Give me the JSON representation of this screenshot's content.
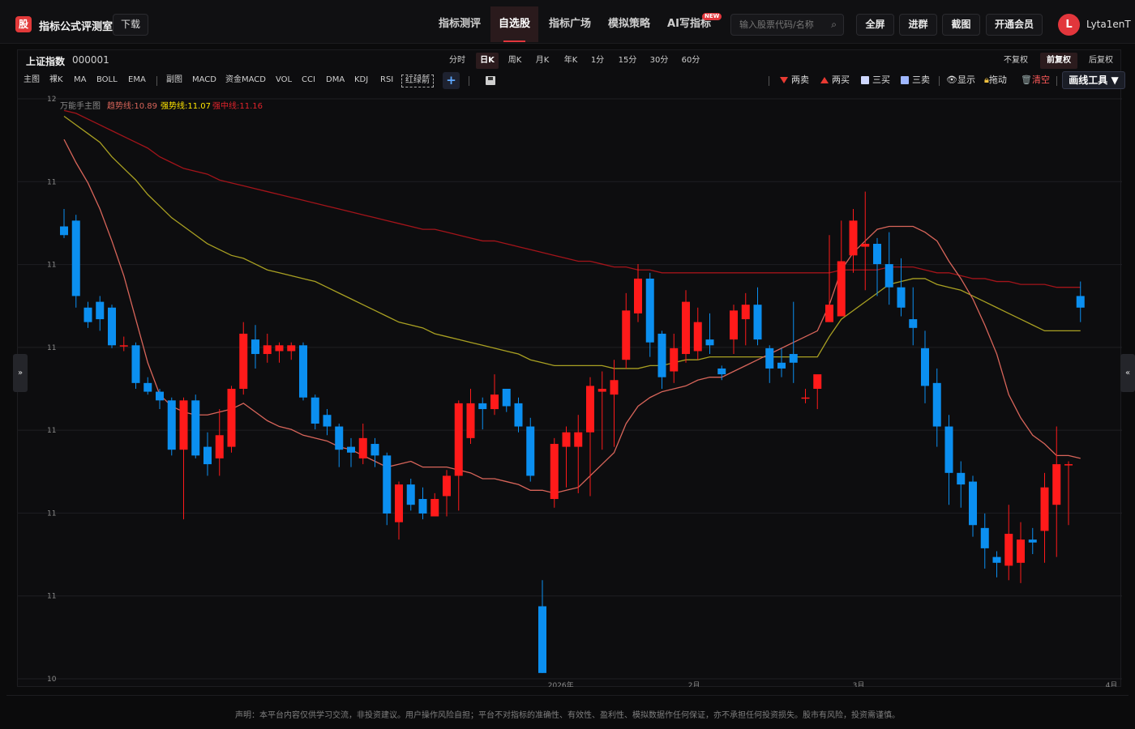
{
  "app": {
    "logo_char": "股",
    "title": "指标公式评测室",
    "download": "下载"
  },
  "nav": [
    {
      "label": "指标测评"
    },
    {
      "label": "自选股"
    },
    {
      "label": "指标广场"
    },
    {
      "label": "模拟策略"
    },
    {
      "label": "AI写指标"
    }
  ],
  "nav_badge": "NEW",
  "search": {
    "placeholder": "输入股票代码/名称",
    "icon": "search-icon"
  },
  "top_buttons": {
    "fullscreen": "全屏",
    "join_group": "进群",
    "screenshot": "截图",
    "membership": "开通会员"
  },
  "user": {
    "avatar_char": "L",
    "name": "Lyta1enT"
  },
  "stock": {
    "name": "上证指数",
    "code": "000001"
  },
  "periods": [
    "分时",
    "日K",
    "周K",
    "月K",
    "年K",
    "1分",
    "15分",
    "30分",
    "60分"
  ],
  "active_period": "日K",
  "adjust": [
    "不复权",
    "前复权",
    "后复权"
  ],
  "active_adjust": "前复权",
  "indicators_main": [
    "主图",
    "裸K",
    "MA",
    "BOLL",
    "EMA"
  ],
  "indicators_sub": [
    "副图",
    "MACD",
    "资金MACD",
    "VOL",
    "CCI",
    "DMA",
    "KDJ",
    "RSI"
  ],
  "indicator_special": "红绿箭",
  "add_label": "+",
  "draw": {
    "sell2": "两卖",
    "buy2": "两买",
    "buy3": "三买",
    "sell3": "三卖",
    "show": "显示",
    "drag": "拖动",
    "clear": "清空",
    "tools": "画线工具 ▼"
  },
  "side_tabs": {
    "left": "»",
    "right": "«"
  },
  "chart_legend": {
    "name": "万能手主图",
    "trend_label": "趋势线:10.89",
    "strong_label": "强势线:11.07",
    "mid_label": "强中线:11.16"
  },
  "chart_data": {
    "type": "candlestick",
    "y_tick_labels": [
      "12",
      "11",
      "11",
      "11",
      "11",
      "11",
      "11",
      "10"
    ],
    "x_tick_labels": [
      "2026年",
      "2月",
      "3月",
      "4月"
    ],
    "ylim": [
      10.0,
      12.0
    ],
    "colors": {
      "up": "#ff1a1a",
      "down": "#0b8ff0",
      "trend": "#d8655a",
      "strong": "#a9a022",
      "mid": "#a3141a",
      "signal": "#ffe600",
      "signal_blue": "#2244ff"
    },
    "candles": [
      [
        11.56,
        11.53,
        11.62,
        11.52
      ],
      [
        11.58,
        11.32,
        11.6,
        11.28
      ],
      [
        11.28,
        11.23,
        11.3,
        11.21
      ],
      [
        11.3,
        11.24,
        11.32,
        11.2
      ],
      [
        11.28,
        11.15,
        11.29,
        11.14
      ],
      [
        11.15,
        11.15,
        11.18,
        11.13
      ],
      [
        11.15,
        11.02,
        11.16,
        11.0
      ],
      [
        11.02,
        10.99,
        11.04,
        10.98
      ],
      [
        10.99,
        10.96,
        11.0,
        10.93
      ],
      [
        10.96,
        10.79,
        10.97,
        10.77
      ],
      [
        10.79,
        10.96,
        10.97,
        10.55
      ],
      [
        10.96,
        10.77,
        10.98,
        10.76
      ],
      [
        10.8,
        10.74,
        10.85,
        10.7
      ],
      [
        10.76,
        10.84,
        10.93,
        10.7
      ],
      [
        10.8,
        11.0,
        11.01,
        10.78
      ],
      [
        11.0,
        11.19,
        11.23,
        10.98
      ],
      [
        11.17,
        11.12,
        11.22,
        11.07
      ],
      [
        11.12,
        11.15,
        11.19,
        11.09
      ],
      [
        11.13,
        11.15,
        11.16,
        11.09
      ],
      [
        11.13,
        11.15,
        11.16,
        11.1
      ],
      [
        11.15,
        10.97,
        11.16,
        10.96
      ],
      [
        10.97,
        10.88,
        10.98,
        10.86
      ],
      [
        10.91,
        10.87,
        10.93,
        10.84
      ],
      [
        10.87,
        10.79,
        10.88,
        10.73
      ],
      [
        10.8,
        10.78,
        10.83,
        10.73
      ],
      [
        10.76,
        10.83,
        10.88,
        10.74
      ],
      [
        10.81,
        10.77,
        10.83,
        10.73
      ],
      [
        10.77,
        10.57,
        10.78,
        10.53
      ],
      [
        10.54,
        10.67,
        10.68,
        10.48
      ],
      [
        10.67,
        10.6,
        10.69,
        10.58
      ],
      [
        10.62,
        10.57,
        10.66,
        10.55
      ],
      [
        10.56,
        10.62,
        10.64,
        10.56
      ],
      [
        10.63,
        10.7,
        10.72,
        10.56
      ],
      [
        10.7,
        10.95,
        10.96,
        10.58
      ],
      [
        10.83,
        10.95,
        11.0,
        10.81
      ],
      [
        10.95,
        10.93,
        10.97,
        10.86
      ],
      [
        10.93,
        10.98,
        11.05,
        10.91
      ],
      [
        11.0,
        10.94,
        11.0,
        10.92
      ],
      [
        10.95,
        10.87,
        10.97,
        10.85
      ],
      [
        10.87,
        10.7,
        10.9,
        10.68
      ],
      [
        10.25,
        10.02,
        10.34,
        10.02
      ],
      [
        10.62,
        10.81,
        10.83,
        10.59
      ],
      [
        10.8,
        10.85,
        10.87,
        10.66
      ],
      [
        10.8,
        10.85,
        10.91,
        10.64
      ],
      [
        10.85,
        11.01,
        11.04,
        10.63
      ],
      [
        10.99,
        11.0,
        11.06,
        10.79
      ],
      [
        10.98,
        11.03,
        11.1,
        10.8
      ],
      [
        11.1,
        11.27,
        11.33,
        11.07
      ],
      [
        11.26,
        11.38,
        11.43,
        11.23
      ],
      [
        11.38,
        11.16,
        11.4,
        11.11
      ],
      [
        11.19,
        11.04,
        11.2,
        11.0
      ],
      [
        11.06,
        11.14,
        11.19,
        11.02
      ],
      [
        11.12,
        11.3,
        11.34,
        11.09
      ],
      [
        11.13,
        11.23,
        11.28,
        11.1
      ],
      [
        11.17,
        11.15,
        11.26,
        11.12
      ],
      [
        11.07,
        11.05,
        11.08,
        11.03
      ],
      [
        11.17,
        11.27,
        11.29,
        11.12
      ],
      [
        11.24,
        11.29,
        11.33,
        11.15
      ],
      [
        11.29,
        11.17,
        11.35,
        11.15
      ],
      [
        11.14,
        11.07,
        11.15,
        11.02
      ],
      [
        11.09,
        11.07,
        11.14,
        11.04
      ],
      [
        11.12,
        11.09,
        11.3,
        11.02
      ],
      [
        10.97,
        10.97,
        11.0,
        10.95
      ],
      [
        11.0,
        11.05,
        11.03,
        10.93
      ],
      [
        11.23,
        11.29,
        11.53,
        11.24
      ],
      [
        11.25,
        11.44,
        11.58,
        11.25
      ],
      [
        11.46,
        11.58,
        11.62,
        11.4
      ],
      [
        11.49,
        11.5,
        11.68,
        11.34
      ],
      [
        11.5,
        11.43,
        11.52,
        11.32
      ],
      [
        11.43,
        11.35,
        11.54,
        11.29
      ],
      [
        11.35,
        11.28,
        11.45,
        11.25
      ],
      [
        11.24,
        11.21,
        11.35,
        11.15
      ],
      [
        11.14,
        11.01,
        11.2,
        10.95
      ],
      [
        11.02,
        10.87,
        11.07,
        10.8
      ],
      [
        10.87,
        10.71,
        10.91,
        10.6
      ],
      [
        10.71,
        10.67,
        10.75,
        10.59
      ],
      [
        10.68,
        10.53,
        10.7,
        10.49
      ],
      [
        10.52,
        10.45,
        10.57,
        10.38
      ],
      [
        10.42,
        10.4,
        10.44,
        10.35
      ],
      [
        10.39,
        10.5,
        10.6,
        10.34
      ],
      [
        10.4,
        10.48,
        10.54,
        10.33
      ],
      [
        10.48,
        10.47,
        10.52,
        10.43
      ],
      [
        10.51,
        10.66,
        10.71,
        10.4
      ],
      [
        10.6,
        10.74,
        10.87,
        10.42
      ],
      [
        10.74,
        10.74,
        10.75,
        10.53
      ],
      [
        11.32,
        11.28,
        11.37,
        11.23
      ]
    ],
    "trend_line": [
      11.86,
      11.78,
      11.71,
      11.62,
      11.51,
      11.39,
      11.24,
      11.09,
      10.98,
      10.94,
      10.92,
      10.91,
      10.91,
      10.92,
      10.93,
      10.95,
      10.92,
      10.89,
      10.87,
      10.86,
      10.84,
      10.83,
      10.82,
      10.8,
      10.79,
      10.77,
      10.75,
      10.73,
      10.74,
      10.75,
      10.73,
      10.73,
      10.73,
      10.72,
      10.71,
      10.69,
      10.69,
      10.68,
      10.67,
      10.65,
      10.65,
      10.64,
      10.65,
      10.66,
      10.7,
      10.74,
      10.78,
      10.88,
      10.94,
      10.97,
      10.99,
      11.0,
      11.01,
      11.03,
      11.04,
      11.04,
      11.06,
      11.08,
      11.1,
      11.12,
      11.14,
      11.16,
      11.18,
      11.2,
      11.29,
      11.41,
      11.47,
      11.51,
      11.55,
      11.56,
      11.56,
      11.56,
      11.54,
      11.51,
      11.44,
      11.38,
      11.31,
      11.22,
      11.12,
      10.98,
      10.9,
      10.84,
      10.81,
      10.77,
      10.77,
      10.76
    ],
    "strong_line": [
      11.94,
      11.91,
      11.88,
      11.85,
      11.8,
      11.76,
      11.72,
      11.67,
      11.63,
      11.59,
      11.56,
      11.53,
      11.5,
      11.48,
      11.46,
      11.45,
      11.43,
      11.41,
      11.4,
      11.39,
      11.38,
      11.37,
      11.35,
      11.33,
      11.31,
      11.29,
      11.27,
      11.25,
      11.23,
      11.22,
      11.21,
      11.19,
      11.18,
      11.17,
      11.16,
      11.15,
      11.14,
      11.13,
      11.12,
      11.1,
      11.09,
      11.08,
      11.08,
      11.08,
      11.08,
      11.08,
      11.07,
      11.07,
      11.07,
      11.08,
      11.08,
      11.09,
      11.1,
      11.1,
      11.11,
      11.11,
      11.11,
      11.11,
      11.11,
      11.11,
      11.11,
      11.11,
      11.11,
      11.11,
      11.18,
      11.24,
      11.27,
      11.3,
      11.33,
      11.36,
      11.37,
      11.38,
      11.38,
      11.36,
      11.35,
      11.34,
      11.32,
      11.3,
      11.28,
      11.26,
      11.24,
      11.22,
      11.2,
      11.2,
      11.2,
      11.2
    ],
    "mid_line": [
      11.96,
      11.95,
      11.93,
      11.91,
      11.89,
      11.87,
      11.85,
      11.83,
      11.8,
      11.78,
      11.76,
      11.75,
      11.74,
      11.72,
      11.71,
      11.7,
      11.69,
      11.68,
      11.67,
      11.66,
      11.65,
      11.64,
      11.63,
      11.62,
      11.61,
      11.6,
      11.59,
      11.58,
      11.57,
      11.56,
      11.55,
      11.55,
      11.54,
      11.53,
      11.52,
      11.51,
      11.51,
      11.5,
      11.49,
      11.48,
      11.47,
      11.46,
      11.45,
      11.44,
      11.44,
      11.43,
      11.42,
      11.42,
      11.41,
      11.41,
      11.4,
      11.4,
      11.4,
      11.4,
      11.4,
      11.4,
      11.4,
      11.4,
      11.4,
      11.4,
      11.4,
      11.4,
      11.4,
      11.4,
      11.4,
      11.41,
      11.41,
      11.41,
      11.41,
      11.42,
      11.42,
      11.42,
      11.41,
      11.4,
      11.4,
      11.39,
      11.38,
      11.38,
      11.37,
      11.37,
      11.36,
      11.36,
      11.36,
      11.35,
      11.35,
      11.35
    ]
  },
  "disclaimer": "声明：本平台内容仅供学习交流，非投资建议。用户操作风险自担；平台不对指标的准确性、有效性、盈利性、模拟数据作任何保证，亦不承担任何投资损失。股市有风险，投资需谨慎。"
}
